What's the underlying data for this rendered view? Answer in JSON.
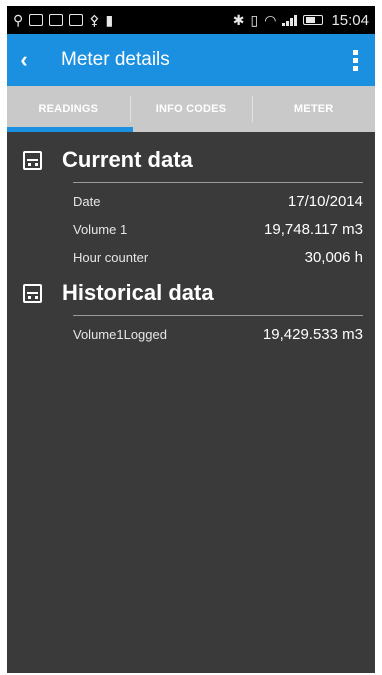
{
  "status_bar": {
    "time": "15:04",
    "left_icons": [
      "gps-icon",
      "image-icon",
      "message-icon",
      "message-icon",
      "usb-icon",
      "notification-icon"
    ],
    "right_icons": [
      "bluetooth-icon",
      "vibrate-icon",
      "wifi-icon",
      "signal-icon",
      "battery-icon"
    ]
  },
  "action_bar": {
    "back_glyph": "‹",
    "title": "Meter details",
    "color": "#1b8fe0"
  },
  "tabs": [
    {
      "label": "READINGS",
      "selected": true
    },
    {
      "label": "INFO CODES",
      "selected": false
    },
    {
      "label": "METER",
      "selected": false
    }
  ],
  "sections": [
    {
      "title": "Current data",
      "icon": "meter-icon",
      "rows": [
        {
          "label": "Date",
          "value": "17/10/2014"
        },
        {
          "label": "Volume 1",
          "value": "19,748.117 m3"
        },
        {
          "label": "Hour counter",
          "value": "30,006 h"
        }
      ]
    },
    {
      "title": "Historical data",
      "icon": "meter-icon",
      "rows": [
        {
          "label": "Volume1Logged",
          "value": "19,429.533 m3"
        }
      ]
    }
  ]
}
